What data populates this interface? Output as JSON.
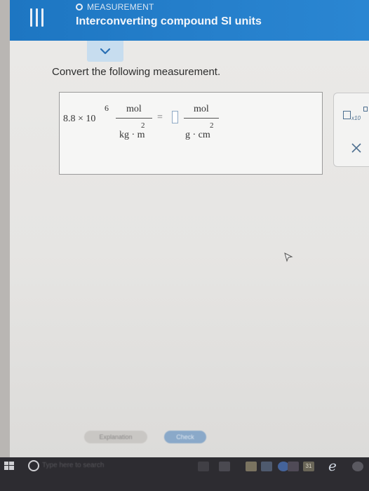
{
  "header": {
    "topic": "MEASUREMENT",
    "title": "Interconverting compound SI units"
  },
  "prompt": "Convert the following measurement.",
  "expression": {
    "coefficient": "8.8 × 10",
    "exponent": "6",
    "given_numerator": "mol",
    "given_denominator_base": "kg · m",
    "given_denominator_exponent": "2",
    "equals": "=",
    "target_numerator": "mol",
    "target_denominator_base": "g · cm",
    "target_denominator_exponent": "2"
  },
  "side_panel": {
    "x10_label": "x10"
  },
  "buttons": {
    "explanation": "Explanation",
    "check": "Check"
  },
  "taskbar": {
    "search_placeholder": "Type here to search",
    "store_badge": "31"
  },
  "icons": {
    "menu": "hamburger-icon",
    "topic": "circle-icon",
    "collapse": "chevron-down-icon",
    "close": "close-icon",
    "cursor": "mouse-cursor-icon",
    "edge": "edge-browser-icon"
  },
  "colors": {
    "header": "#1d76c2",
    "chevron_tab": "#c7ddef",
    "accent": "#4d6f8f",
    "taskbar": "#2d2c31"
  }
}
